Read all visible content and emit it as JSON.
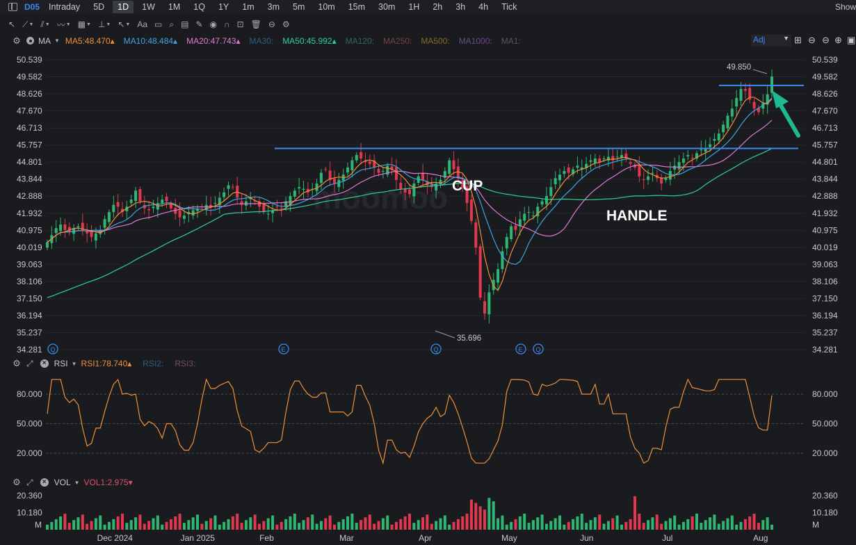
{
  "timeframe_bar": {
    "symbol": "D05",
    "items": [
      "Intraday",
      "5D",
      "1D",
      "1W",
      "1M",
      "1Q",
      "1Y",
      "1m",
      "3m",
      "5m",
      "10m",
      "15m",
      "30m",
      "1H",
      "2h",
      "3h",
      "4h",
      "Tick"
    ],
    "active": "1D",
    "right_label": "Show"
  },
  "toolbar": {
    "tools": [
      {
        "icon": "cursor-arrow-icon",
        "glyph": "↖",
        "caret": false
      },
      {
        "icon": "trend-line-icon",
        "glyph": "⟋",
        "caret": true
      },
      {
        "icon": "channel-tool-icon",
        "glyph": "⫽",
        "caret": true
      },
      {
        "icon": "wave-tool-icon",
        "glyph": "〰",
        "caret": true
      },
      {
        "icon": "fibonacci-icon",
        "glyph": "▦",
        "caret": true
      },
      {
        "icon": "measure-icon",
        "glyph": "⊥",
        "caret": true
      },
      {
        "icon": "arrow-tool-icon",
        "glyph": "↖",
        "caret": true
      },
      {
        "icon": "text-tool-icon",
        "glyph": "Aa",
        "caret": false
      },
      {
        "icon": "comment-icon",
        "glyph": "▭",
        "caret": false
      },
      {
        "icon": "zoom-icon",
        "glyph": "⌕",
        "caret": false
      },
      {
        "icon": "save-drawing-icon",
        "glyph": "▤",
        "caret": false
      },
      {
        "icon": "pen-icon",
        "glyph": "✎",
        "caret": false
      },
      {
        "icon": "visibility-icon",
        "glyph": "◉",
        "caret": false
      },
      {
        "icon": "magnet-icon",
        "glyph": "∩",
        "caret": false
      },
      {
        "icon": "lock-icon",
        "glyph": "⊡",
        "caret": false
      },
      {
        "icon": "trash-icon",
        "glyph": "🗑",
        "caret": false
      },
      {
        "icon": "sync-icon",
        "glyph": "⊖",
        "caret": false
      },
      {
        "icon": "settings-icon",
        "glyph": "⚙",
        "caret": false
      }
    ]
  },
  "main_indicators": {
    "label": "MA",
    "items": [
      {
        "text": "MA5:48.470",
        "color": "#f0903a",
        "arrow": "▴"
      },
      {
        "text": "MA10:48.484",
        "color": "#3fa6e0",
        "arrow": "▴"
      },
      {
        "text": "MA20:47.743",
        "color": "#e07ad8",
        "arrow": "▴"
      },
      {
        "text": "MA30:",
        "color": "#2f5e82",
        "arrow": ""
      },
      {
        "text": "MA50:45.992",
        "color": "#2fd09a",
        "arrow": "▴"
      },
      {
        "text": "MA120:",
        "color": "#2d6a5a",
        "arrow": ""
      },
      {
        "text": "MA250:",
        "color": "#7a3e4a",
        "arrow": ""
      },
      {
        "text": "MA500:",
        "color": "#8a6a2a",
        "arrow": ""
      },
      {
        "text": "MA1000:",
        "color": "#6a4a8a",
        "arrow": ""
      },
      {
        "text": "MA1:",
        "color": "#555860",
        "arrow": ""
      }
    ],
    "adj_label": "Adj"
  },
  "rsi_row": {
    "label": "RSI",
    "items": [
      {
        "text": "RSI1:78.740",
        "color": "#f0903a",
        "arrow": "▴"
      },
      {
        "text": "RSI2:",
        "color": "#2f5e82",
        "arrow": ""
      },
      {
        "text": "RSI3:",
        "color": "#7a4a6a",
        "arrow": ""
      }
    ]
  },
  "vol_row": {
    "label": "VOL",
    "items": [
      {
        "text": "VOL1:2.975",
        "color": "#e0506a",
        "arrow": "▾"
      }
    ]
  },
  "annotations": {
    "cup": "CUP",
    "handle": "HANDLE",
    "high_label": "49.850",
    "low_label": "35.696",
    "event_markers": [
      "Q",
      "E",
      "Q",
      "E",
      "Q"
    ]
  },
  "chart_data": {
    "type": "candlestick",
    "price_axis_ticks": [
      "50.539",
      "49.582",
      "48.626",
      "47.670",
      "46.713",
      "45.757",
      "44.801",
      "43.844",
      "42.888",
      "41.932",
      "40.975",
      "40.019",
      "39.063",
      "38.106",
      "37.150",
      "36.194",
      "35.237",
      "34.281"
    ],
    "price_range": [
      34.281,
      50.539
    ],
    "x_labels": [
      "Dec 2024",
      "Jan 2025",
      "Feb",
      "Mar",
      "Apr",
      "May",
      "Jun",
      "Jul",
      "Aug"
    ],
    "resistance_levels": [
      45.57,
      49.1
    ],
    "rsi_axis_ticks": [
      "80.000",
      "50.000",
      "20.000"
    ],
    "vol_axis_ticks": [
      "20.360",
      "10.180"
    ],
    "vol_unit": "M",
    "closes": [
      40.3,
      40.7,
      41.1,
      41.3,
      41.0,
      40.9,
      41.1,
      41.2,
      41.0,
      40.8,
      40.6,
      40.8,
      41.0,
      41.6,
      42.0,
      42.4,
      42.3,
      42.0,
      42.3,
      42.7,
      43.2,
      42.6,
      42.2,
      42.1,
      42.3,
      42.5,
      42.7,
      42.6,
      42.2,
      41.9,
      41.7,
      41.8,
      42.0,
      42.1,
      42.2,
      42.3,
      42.4,
      42.3,
      42.5,
      42.8,
      43.1,
      43.5,
      43.4,
      42.8,
      42.4,
      42.6,
      42.8,
      42.6,
      42.3,
      42.0,
      41.9,
      42.1,
      42.3,
      42.2,
      42.6,
      42.9,
      43.2,
      43.4,
      43.3,
      43.1,
      43.3,
      43.6,
      44.2,
      44.4,
      43.8,
      43.6,
      43.8,
      44.1,
      44.5,
      44.9,
      45.2,
      45.0,
      44.8,
      44.7,
      44.5,
      44.2,
      44.3,
      44.6,
      44.4,
      43.8,
      43.3,
      43.1,
      43.0,
      43.6,
      44.0,
      43.8,
      43.5,
      43.4,
      43.6,
      43.8,
      44.3,
      44.9,
      44.4,
      43.9,
      43.4,
      42.5,
      41.5,
      40.0,
      37.2,
      36.3,
      37.5,
      38.2,
      38.8,
      39.8,
      40.6,
      41.2,
      41.0,
      41.6,
      41.9,
      42.0,
      41.8,
      42.3,
      42.6,
      42.9,
      43.4,
      43.9,
      44.1,
      44.3,
      44.2,
      44.4,
      44.6,
      44.5,
      44.7,
      44.9,
      45.0,
      44.8,
      45.0,
      45.1,
      44.9,
      45.1,
      45.2,
      45.0,
      44.7,
      44.5,
      44.0,
      43.8,
      44.0,
      44.2,
      43.9,
      43.6,
      43.9,
      44.3,
      44.6,
      44.8,
      45.0,
      45.2,
      45.0,
      45.3,
      45.5,
      45.6,
      45.8,
      46.1,
      46.4,
      46.9,
      47.4,
      47.8,
      48.4,
      48.9,
      48.8,
      48.3,
      47.8,
      47.6,
      48.1,
      48.6,
      49.6
    ],
    "ma5_last": 48.47,
    "ma10_last": 48.484,
    "ma20_last": 47.743,
    "ma50_last": 45.992,
    "rsi1_last": 78.74,
    "vol1_last": 2.975
  }
}
